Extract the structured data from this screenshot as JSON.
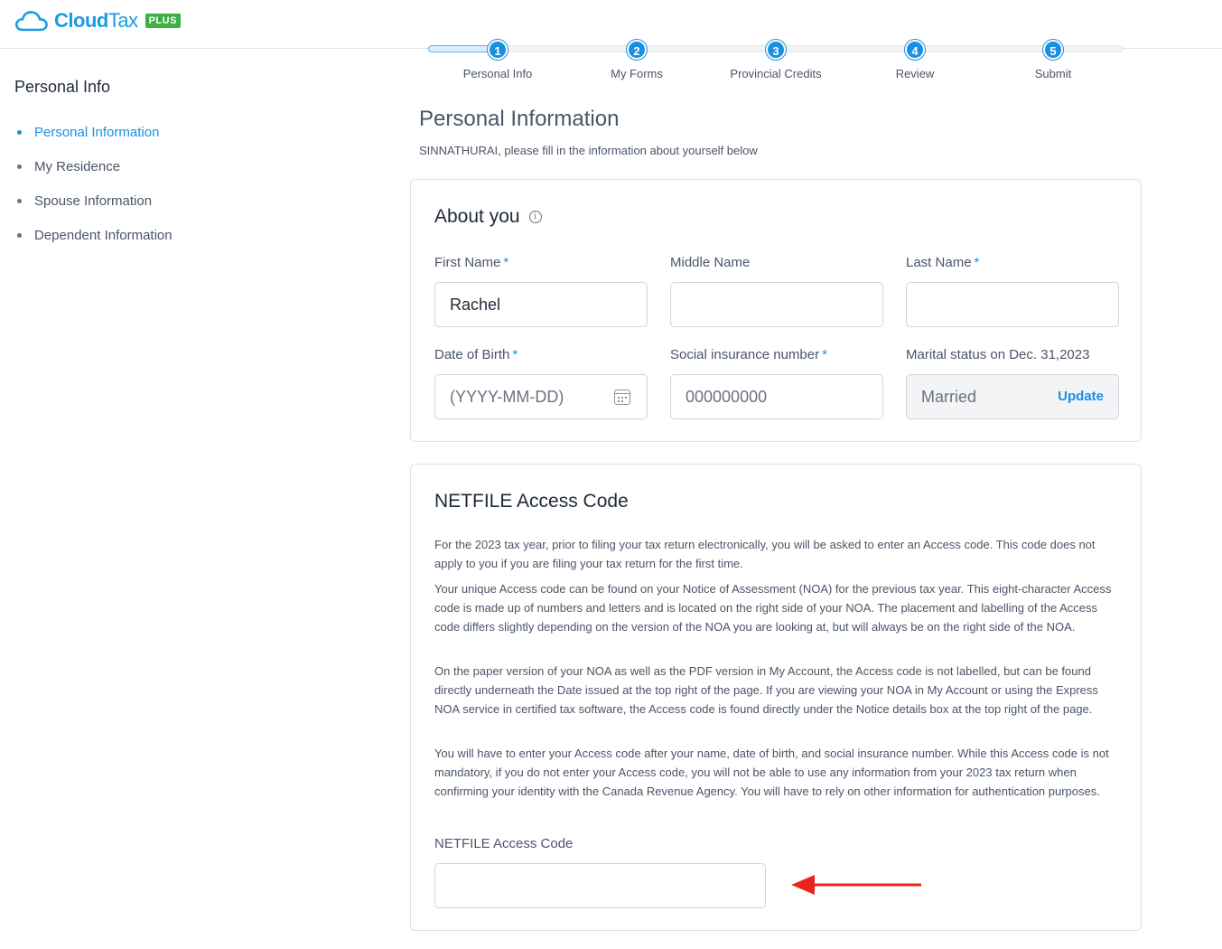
{
  "header": {
    "logo_cloud": "Cloud",
    "logo_tax": "Tax",
    "logo_badge": "PLUS"
  },
  "sidebar": {
    "title": "Personal Info",
    "items": [
      {
        "label": "Personal Information",
        "active": true
      },
      {
        "label": "My Residence",
        "active": false
      },
      {
        "label": "Spouse Information",
        "active": false
      },
      {
        "label": "Dependent Information",
        "active": false
      }
    ]
  },
  "stepper": {
    "steps": [
      {
        "number": "1",
        "label": "Personal Info"
      },
      {
        "number": "2",
        "label": "My Forms"
      },
      {
        "number": "3",
        "label": "Provincial Credits"
      },
      {
        "number": "4",
        "label": "Review"
      },
      {
        "number": "5",
        "label": "Submit"
      }
    ]
  },
  "main": {
    "title": "Personal Information",
    "subtitle": "SINNATHURAI, please fill in the information about yourself below"
  },
  "about": {
    "heading": "About you",
    "info_glyph": "i",
    "required_mark": "*",
    "first_name": {
      "label": "First Name",
      "value": "Rachel"
    },
    "middle_name": {
      "label": "Middle Name",
      "value": ""
    },
    "last_name": {
      "label": "Last Name",
      "value": ""
    },
    "dob": {
      "label": "Date of Birth",
      "placeholder": "(YYYY-MM-DD)"
    },
    "sin": {
      "label": "Social insurance number",
      "placeholder": "000000000"
    },
    "marital": {
      "label": "Marital status on Dec. 31,2023",
      "value": "Married",
      "action": "Update"
    }
  },
  "netfile": {
    "heading": "NETFILE Access Code",
    "paragraphs": [
      "For the 2023 tax year, prior to filing your tax return electronically, you will be asked to enter an Access code. This code does not apply to you if you are filing your tax return for the first time.",
      "Your unique Access code can be found on your Notice of Assessment (NOA) for the previous tax year. This eight-character Access code is made up of numbers and letters and is located on the right side of your NOA. The placement and labelling of the Access code differs slightly depending on the version of the NOA you are looking at, but will always be on the right side of the NOA.",
      "On the paper version of your NOA as well as the PDF version in My Account, the Access code is not labelled, but can be found directly underneath the Date issued at the top right of the page. If you are viewing your NOA in My Account or using the Express NOA service in certified tax software, the Access code is found directly under the Notice details box at the top right of the page.",
      "You will have to enter your Access code after your name, date of birth, and social insurance number. While this Access code is not mandatory, if you do not enter your Access code, you will not be able to use any information from your 2023 tax return when confirming your identity with the Canada Revenue Agency. You will have to rely on other information for authentication purposes."
    ],
    "field_label": "NETFILE Access Code",
    "field_value": ""
  },
  "colors": {
    "accent": "#1a8fe0",
    "brand_green": "#3cb043",
    "arrow_red": "#e8251a"
  },
  "icons": [
    "cloud-logo-icon",
    "info-icon",
    "calendar-icon",
    "red-arrow-annotation"
  ]
}
